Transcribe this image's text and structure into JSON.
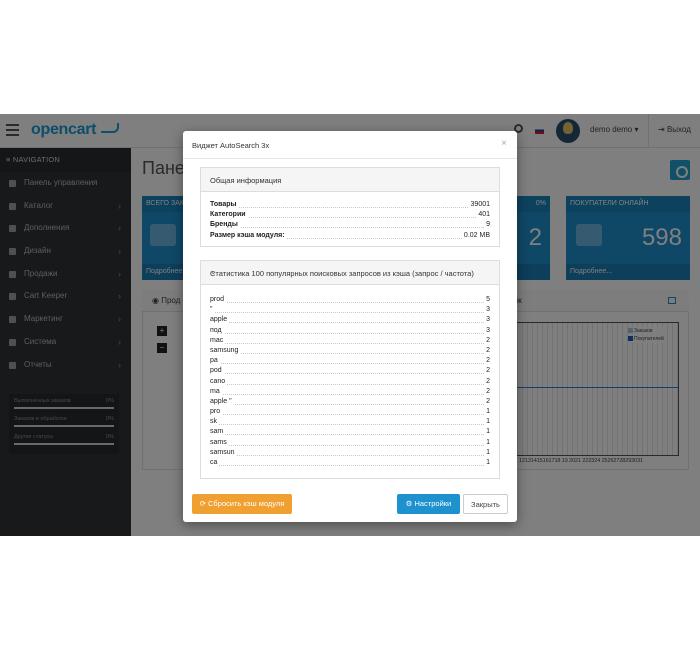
{
  "header": {
    "logo": "opencart",
    "user": "demo demo",
    "logout": "Выход"
  },
  "sidebar": {
    "title": "NAVIGATION",
    "items": [
      {
        "label": "Панель управления",
        "chev": false
      },
      {
        "label": "Каталог",
        "chev": true
      },
      {
        "label": "Дополнения",
        "chev": true
      },
      {
        "label": "Дизайн",
        "chev": true
      },
      {
        "label": "Продажи",
        "chev": true
      },
      {
        "label": "Cart Keeper",
        "chev": true
      },
      {
        "label": "Маркетинг",
        "chev": true
      },
      {
        "label": "Система",
        "chev": true
      },
      {
        "label": "Отчеты",
        "chev": true
      }
    ],
    "stats": [
      {
        "label": "Выполненных заказов",
        "pct": "0%"
      },
      {
        "label": "Заказов в обработке",
        "pct": "0%"
      },
      {
        "label": "Другие статусы",
        "pct": "0%"
      }
    ]
  },
  "dashboard": {
    "title": "Панел",
    "tile_left_head": "ВСЕГО ЗАК",
    "tile_left_foot": "Подробнее",
    "tile_mid_pct": "0%",
    "tile_mid_value": "2",
    "tile_right_head": "ПОКУПАТЕЛИ ОНЛАЙН",
    "tile_right_value": "598",
    "tile_right_foot": "Подробнее...",
    "panel_title": "Прод",
    "panel_right": "аж",
    "legend": [
      "Заказов",
      "Покупателей"
    ],
    "xaxis": "11 12131415161718 19 2021 222324 25262728293031",
    "legend_colors": [
      "#a6c8ea",
      "#1f5fb4"
    ]
  },
  "modal": {
    "title": "Виджет AutoSearch 3x",
    "info_title": "Общая информация",
    "info": [
      {
        "k": "Товары",
        "v": "39001"
      },
      {
        "k": "Категории",
        "v": "401"
      },
      {
        "k": "Бренды",
        "v": "9"
      },
      {
        "k": "Размер кэша модуля:",
        "v": "0.02 MB"
      }
    ],
    "stats_title": "Статистика 100 популярных поисковых запросов из кэша (запрос / частота)",
    "queries": [
      {
        "k": "prod",
        "v": "5"
      },
      {
        "k": "\"",
        "v": "3"
      },
      {
        "k": "apple",
        "v": "3"
      },
      {
        "k": "под",
        "v": "3"
      },
      {
        "k": "mac",
        "v": "2"
      },
      {
        "k": "samsung",
        "v": "2"
      },
      {
        "k": "pa",
        "v": "2"
      },
      {
        "k": "pod",
        "v": "2"
      },
      {
        "k": "cano",
        "v": "2"
      },
      {
        "k": "ma",
        "v": "2"
      },
      {
        "k": "apple \"",
        "v": "2"
      },
      {
        "k": "pro",
        "v": "1"
      },
      {
        "k": "sk",
        "v": "1"
      },
      {
        "k": "sam",
        "v": "1"
      },
      {
        "k": "sams",
        "v": "1"
      },
      {
        "k": "samsun",
        "v": "1"
      },
      {
        "k": "ca",
        "v": "1"
      }
    ],
    "btn_reset": "Сбросить кэш модуля",
    "btn_settings": "Настройки",
    "btn_close": "Закрыть"
  }
}
